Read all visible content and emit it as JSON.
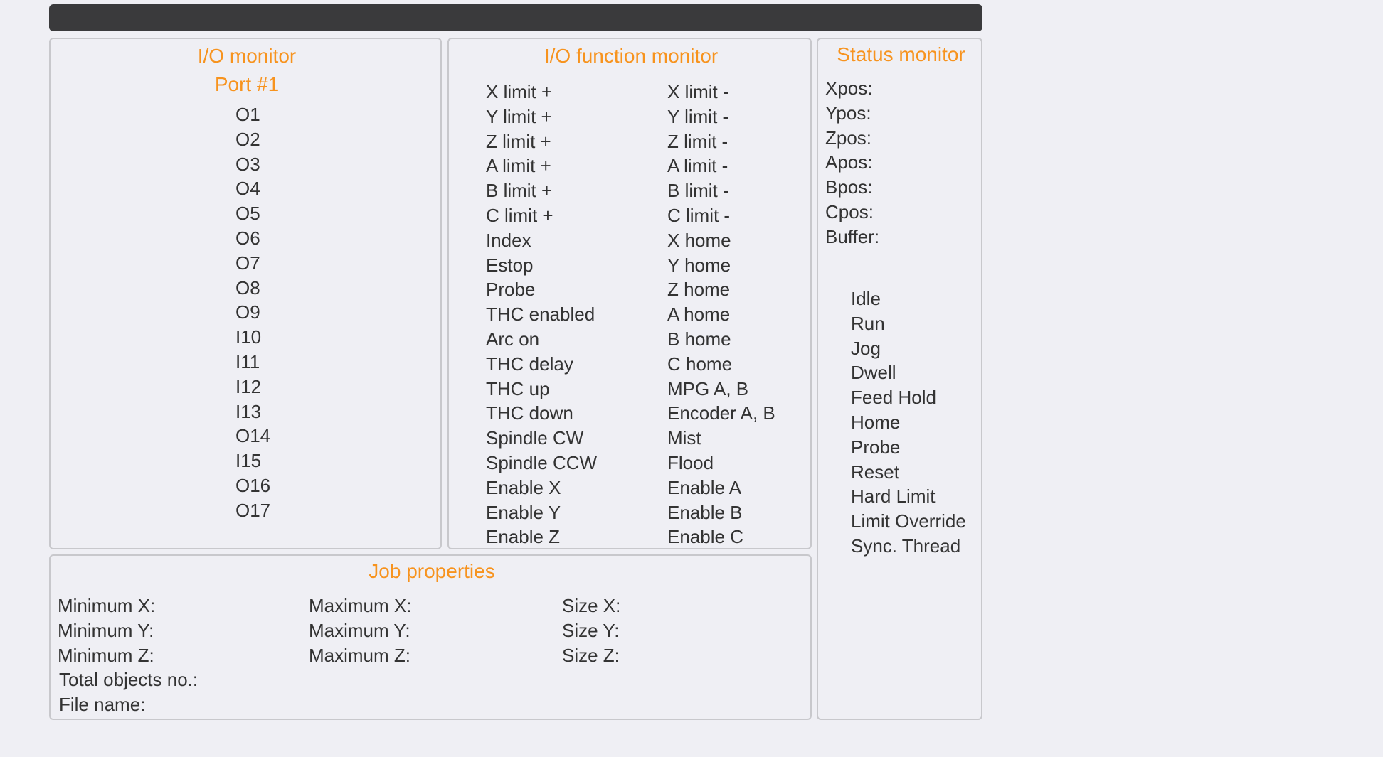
{
  "io_monitor": {
    "title": "I/O monitor",
    "port_title": "Port  #1",
    "pins": [
      "O1",
      "O2",
      "O3",
      "O4",
      "O5",
      "O6",
      "O7",
      "O8",
      "O9",
      "I10",
      "I11",
      "I12",
      "I13",
      "O14",
      "I15",
      "O16",
      "O17"
    ]
  },
  "io_function_monitor": {
    "title": "I/O function monitor",
    "left_column": [
      "X limit +",
      "Y limit +",
      "Z limit +",
      "A limit +",
      "B limit +",
      "C limit +",
      "Index",
      "Estop",
      "Probe",
      "THC enabled",
      "Arc on",
      "THC delay",
      "THC up",
      "THC down",
      "Spindle CW",
      "Spindle CCW",
      "Enable X",
      "Enable Y",
      "Enable Z"
    ],
    "right_column": [
      "X limit -",
      "Y limit -",
      "Z limit -",
      "A limit -",
      "B limit -",
      "C limit -",
      "X home",
      "Y home",
      "Z home",
      "A home",
      "B home",
      "C home",
      "MPG A, B",
      "Encoder A, B",
      "Mist",
      "Flood",
      "Enable A",
      "Enable B",
      "Enable C"
    ]
  },
  "status_monitor": {
    "title": "Status monitor",
    "fields": [
      "Xpos:",
      "Ypos:",
      "Zpos:",
      "Apos:",
      "Bpos:",
      "Cpos:",
      "Buffer:"
    ],
    "states": [
      "Idle",
      "Run",
      "Jog",
      "Dwell",
      "Feed Hold",
      "Home",
      "Probe",
      "Reset",
      "Hard Limit",
      "Limit Override",
      "Sync. Thread"
    ]
  },
  "job_properties": {
    "title": "Job properties",
    "minimum": [
      "Minimum X:",
      "Minimum Y:",
      "Minimum Z:"
    ],
    "maximum": [
      "Maximum X:",
      "Maximum Y:",
      "Maximum Z:"
    ],
    "size": [
      "Size X:",
      "Size Y:",
      "Size Z:"
    ],
    "total_objects_label": "Total objects no.:",
    "file_name_label": "File name:"
  },
  "colors": {
    "accent": "#f7931e",
    "titlebar": "#3a3a3c",
    "background": "#efeff4",
    "panel_border": "#c8c8cc",
    "text": "#333333"
  }
}
